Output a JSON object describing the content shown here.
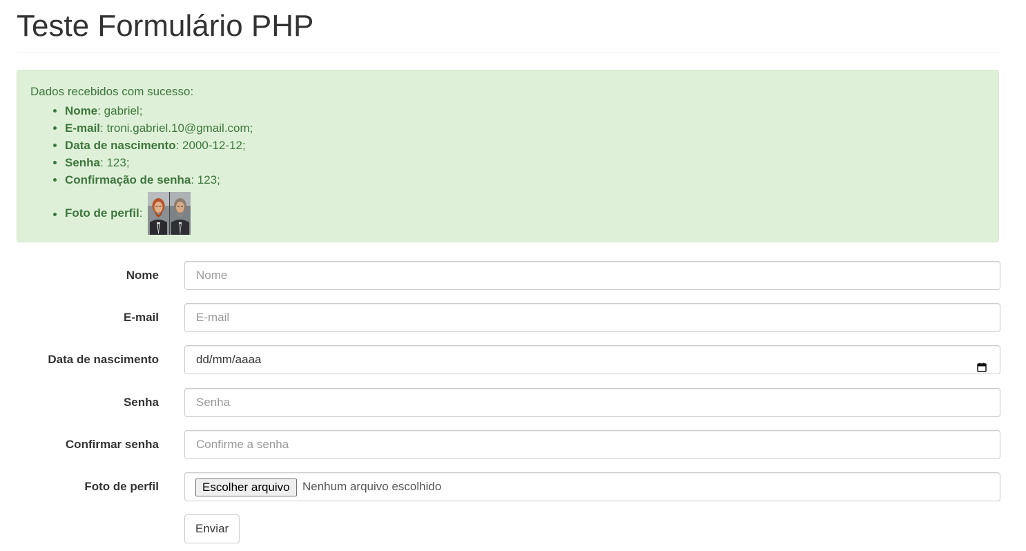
{
  "page": {
    "title": "Teste Formulário PHP"
  },
  "alert": {
    "intro": "Dados recebidos com sucesso:",
    "items": [
      {
        "key": "Nome",
        "value": ": gabriel;"
      },
      {
        "key": "E-mail",
        "value": ": troni.gabriel.10@gmail.com;"
      },
      {
        "key": "Data de nascimento",
        "value": ": 2000-12-12;"
      },
      {
        "key": "Senha",
        "value": ": 123;"
      },
      {
        "key": "Confirmação de senha",
        "value": ": 123;"
      }
    ],
    "photo": {
      "key": "Foto de perfil",
      "separator": ":"
    },
    "colors": {
      "background": "#dff0d8",
      "border": "#d6e9c6",
      "text": "#3c763d"
    }
  },
  "form": {
    "name": {
      "label": "Nome",
      "placeholder": "Nome"
    },
    "email": {
      "label": "E-mail",
      "placeholder": "E-mail"
    },
    "birthdate": {
      "label": "Data de nascimento",
      "placeholder": "dd/mm/aaaa",
      "icon": "calendar-icon"
    },
    "password": {
      "label": "Senha",
      "placeholder": "Senha"
    },
    "confirm_password": {
      "label": "Confirmar senha",
      "placeholder": "Confirme a senha"
    },
    "photo": {
      "label": "Foto de perfil",
      "button": "Escolher arquivo",
      "status": "Nenhum arquivo escolhido"
    },
    "submit": "Enviar"
  }
}
